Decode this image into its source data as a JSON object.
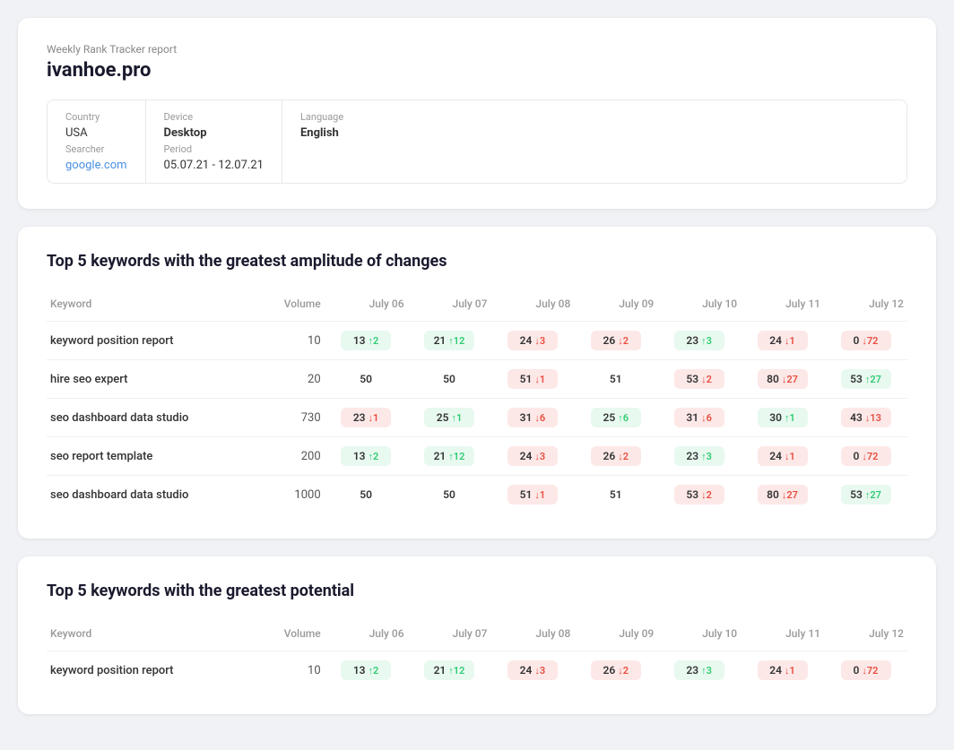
{
  "report": {
    "subtitle": "Weekly Rank Tracker report",
    "domain": "ivanhoe.pro",
    "meta": {
      "country_label": "Country",
      "country_value": "USA",
      "searcher_label": "Searcher",
      "searcher_value": "google.com",
      "device_label": "Device",
      "device_value": "Desktop",
      "period_label": "Period",
      "period_value": "05.07.21 - 12.07.21",
      "language_label": "Language",
      "language_value": "English"
    }
  },
  "amplitude_section": {
    "title": "Top 5 keywords with the greatest amplitude of changes",
    "columns": [
      "Keyword",
      "Volume",
      "July 06",
      "July 07",
      "July 08",
      "July 09",
      "July 10",
      "July 11",
      "July 12"
    ],
    "rows": [
      {
        "keyword": "keyword position report",
        "volume": "10",
        "ranks": [
          {
            "value": "13",
            "delta": "+2",
            "dir": "up",
            "style": "green"
          },
          {
            "value": "21",
            "delta": "+12",
            "dir": "up",
            "style": "green"
          },
          {
            "value": "24",
            "delta": "-3",
            "dir": "down",
            "style": "red"
          },
          {
            "value": "26",
            "delta": "-2",
            "dir": "down",
            "style": "red"
          },
          {
            "value": "23",
            "delta": "+3",
            "dir": "up",
            "style": "green"
          },
          {
            "value": "24",
            "delta": "-1",
            "dir": "down",
            "style": "red"
          },
          {
            "value": "0",
            "delta": "-72",
            "dir": "down",
            "style": "red"
          }
        ]
      },
      {
        "keyword": "hire seo expert",
        "volume": "20",
        "ranks": [
          {
            "value": "50",
            "delta": "",
            "dir": "none",
            "style": "neutral"
          },
          {
            "value": "50",
            "delta": "",
            "dir": "none",
            "style": "neutral"
          },
          {
            "value": "51",
            "delta": "-1",
            "dir": "down",
            "style": "red"
          },
          {
            "value": "51",
            "delta": "",
            "dir": "none",
            "style": "neutral"
          },
          {
            "value": "53",
            "delta": "-2",
            "dir": "down",
            "style": "red"
          },
          {
            "value": "80",
            "delta": "-27",
            "dir": "down",
            "style": "red"
          },
          {
            "value": "53",
            "delta": "+27",
            "dir": "up",
            "style": "green"
          }
        ]
      },
      {
        "keyword": "seo dashboard data studio",
        "volume": "730",
        "ranks": [
          {
            "value": "23",
            "delta": "-1",
            "dir": "down",
            "style": "red"
          },
          {
            "value": "25",
            "delta": "+1",
            "dir": "up",
            "style": "green"
          },
          {
            "value": "31",
            "delta": "-6",
            "dir": "down",
            "style": "red"
          },
          {
            "value": "25",
            "delta": "+6",
            "dir": "up",
            "style": "green"
          },
          {
            "value": "31",
            "delta": "-6",
            "dir": "down",
            "style": "red"
          },
          {
            "value": "30",
            "delta": "+1",
            "dir": "up",
            "style": "green"
          },
          {
            "value": "43",
            "delta": "-13",
            "dir": "down",
            "style": "red"
          }
        ]
      },
      {
        "keyword": "seo report template",
        "volume": "200",
        "ranks": [
          {
            "value": "13",
            "delta": "+2",
            "dir": "up",
            "style": "green"
          },
          {
            "value": "21",
            "delta": "+12",
            "dir": "up",
            "style": "green"
          },
          {
            "value": "24",
            "delta": "-3",
            "dir": "down",
            "style": "red"
          },
          {
            "value": "26",
            "delta": "-2",
            "dir": "down",
            "style": "red"
          },
          {
            "value": "23",
            "delta": "+3",
            "dir": "up",
            "style": "green"
          },
          {
            "value": "24",
            "delta": "-1",
            "dir": "down",
            "style": "red"
          },
          {
            "value": "0",
            "delta": "-72",
            "dir": "down",
            "style": "red"
          }
        ]
      },
      {
        "keyword": "seo dashboard data studio",
        "volume": "1000",
        "ranks": [
          {
            "value": "50",
            "delta": "",
            "dir": "none",
            "style": "neutral"
          },
          {
            "value": "50",
            "delta": "",
            "dir": "none",
            "style": "neutral"
          },
          {
            "value": "51",
            "delta": "-1",
            "dir": "down",
            "style": "red"
          },
          {
            "value": "51",
            "delta": "",
            "dir": "none",
            "style": "neutral"
          },
          {
            "value": "53",
            "delta": "-2",
            "dir": "down",
            "style": "red"
          },
          {
            "value": "80",
            "delta": "-27",
            "dir": "down",
            "style": "red"
          },
          {
            "value": "53",
            "delta": "+27",
            "dir": "up",
            "style": "green"
          }
        ]
      }
    ]
  },
  "potential_section": {
    "title": "Top 5 keywords with the greatest potential",
    "columns": [
      "Keyword",
      "Volume",
      "July 06",
      "July 07",
      "July 08",
      "July 09",
      "July 10",
      "July 11",
      "July 12"
    ],
    "rows": [
      {
        "keyword": "keyword position report",
        "volume": "10",
        "ranks": [
          {
            "value": "13",
            "delta": "+2",
            "dir": "up",
            "style": "green"
          },
          {
            "value": "21",
            "delta": "+12",
            "dir": "up",
            "style": "green"
          },
          {
            "value": "24",
            "delta": "-3",
            "dir": "down",
            "style": "red"
          },
          {
            "value": "26",
            "delta": "-2",
            "dir": "down",
            "style": "red"
          },
          {
            "value": "23",
            "delta": "+3",
            "dir": "up",
            "style": "green"
          },
          {
            "value": "24",
            "delta": "-1",
            "dir": "down",
            "style": "red"
          },
          {
            "value": "0",
            "delta": "-72",
            "dir": "down",
            "style": "red"
          }
        ]
      }
    ]
  }
}
